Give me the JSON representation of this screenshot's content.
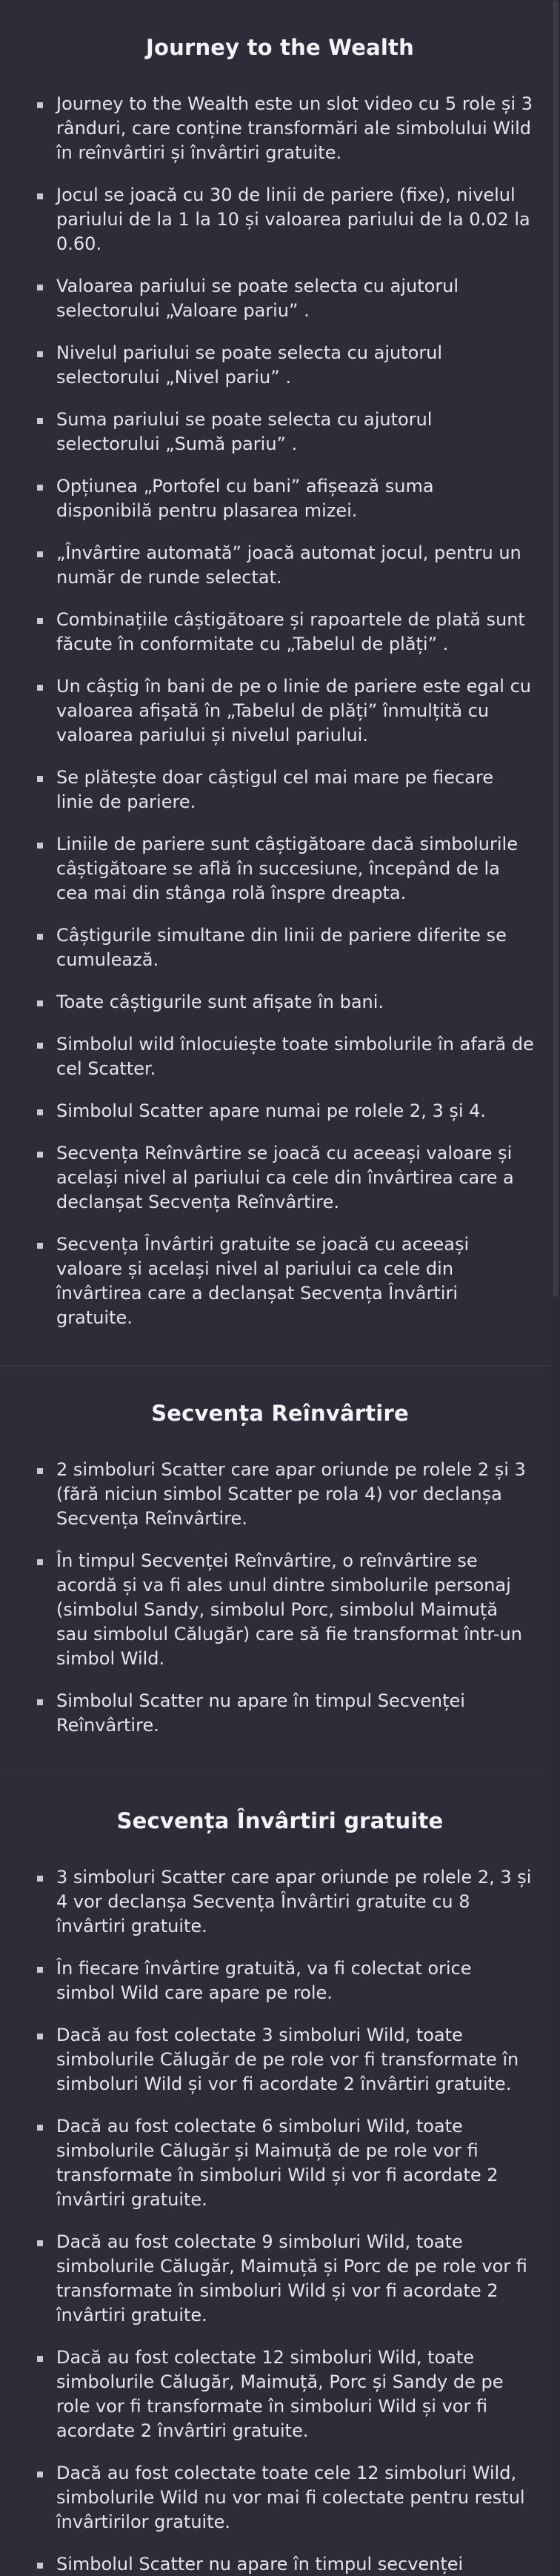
{
  "sections": [
    {
      "title": "Journey to the Wealth",
      "items": [
        "Journey to the Wealth este un slot video cu 5 role și 3 rânduri, care conține transformări ale simbolului Wild în reînvârtiri și învârtiri gratuite.",
        "Jocul se joacă cu 30 de linii de pariere (fixe), nivelul pariului de la 1 la 10 și valoarea pariului de la 0.02 la 0.60.",
        "Valoarea pariului se poate selecta cu ajutorul selectorului „Valoare pariu” .",
        "Nivelul pariului se poate selecta cu ajutorul selectorului „Nivel pariu” .",
        "Suma pariului se poate selecta cu ajutorul selectorului „Sumă pariu” .",
        "Opțiunea „Portofel cu bani”  afișează suma disponibilă pentru plasarea mizei.",
        "„Învârtire automată”  joacă automat jocul, pentru un număr de runde selectat.",
        "Combinațiile câștigătoare și rapoartele de plată sunt făcute în conformitate cu „Tabelul de plăți” .",
        "Un câștig în bani de pe o linie de pariere este egal cu valoarea afișată în „Tabelul de plăți”  înmulțită cu valoarea pariului și nivelul pariului.",
        "Se plătește doar câștigul cel mai mare pe fiecare linie de pariere.",
        "Liniile de pariere sunt câștigătoare dacă simbolurile câștigătoare se află în succesiune, începând de la cea mai din stânga rolă înspre dreapta.",
        "Câștigurile simultane din linii de pariere diferite se cumulează.",
        "Toate câștigurile sunt afișate în bani.",
        "Simbolul wild înlocuiește toate simbolurile în afară de cel Scatter.",
        "Simbolul Scatter apare numai pe rolele 2, 3 și 4.",
        "Secvența Reînvârtire se joacă cu aceeași valoare și același nivel al pariului ca cele din învârtirea care a declanșat Secvența Reînvârtire.",
        "Secvența Învârtiri gratuite se joacă cu aceeași valoare și același nivel al pariului ca cele din învârtirea care a declanșat Secvența Învârtiri gratuite."
      ]
    },
    {
      "title": "Secvența Reînvârtire",
      "items": [
        "2 simboluri Scatter care apar oriunde pe rolele 2 și 3 (fără niciun simbol Scatter pe rola 4) vor declanșa Secvența Reînvârtire.",
        "În timpul Secvenței Reînvârtire, o reînvârtire se acordă și va fi ales unul dintre simbolurile personaj (simbolul Sandy, simbolul Porc, simbolul Maimuță sau simbolul Călugăr) care să fie transformat într-un simbol Wild.",
        "Simbolul Scatter nu apare în timpul Secvenței Reînvârtire."
      ]
    },
    {
      "title": "Secvența Învârtiri gratuite",
      "items": [
        "3 simboluri Scatter care apar oriunde pe rolele 2, 3 și 4 vor declanșa Secvența Învârtiri gratuite cu 8 învârtiri gratuite.",
        "În fiecare învârtire gratuită, va fi colectat orice simbol Wild care apare pe role.",
        "Dacă au fost colectate 3 simboluri Wild, toate simbolurile Călugăr de pe role vor fi transformate în simboluri Wild și vor fi acordate 2 învârtiri gratuite.",
        "Dacă au fost colectate 6 simboluri Wild, toate simbolurile Călugăr și Maimuță de pe role vor fi transformate în simboluri Wild și vor fi acordate 2 învârtiri gratuite.",
        "Dacă au fost colectate 9 simboluri Wild, toate simbolurile Călugăr, Maimuță și Porc de pe role vor fi transformate în simboluri Wild și vor fi acordate 2 învârtiri gratuite.",
        "Dacă au fost colectate 12 simboluri Wild, toate simbolurile Călugăr, Maimuță, Porc și Sandy de pe role vor fi transformate în simboluri Wild și vor fi acordate 2 învârtiri gratuite.",
        "Dacă au fost colectate toate cele 12 simboluri Wild, simbolurile Wild nu vor mai fi colectate pentru restul învârtirilor gratuite.",
        "Simbolul Scatter nu apare în timpul secvenței"
      ]
    }
  ]
}
